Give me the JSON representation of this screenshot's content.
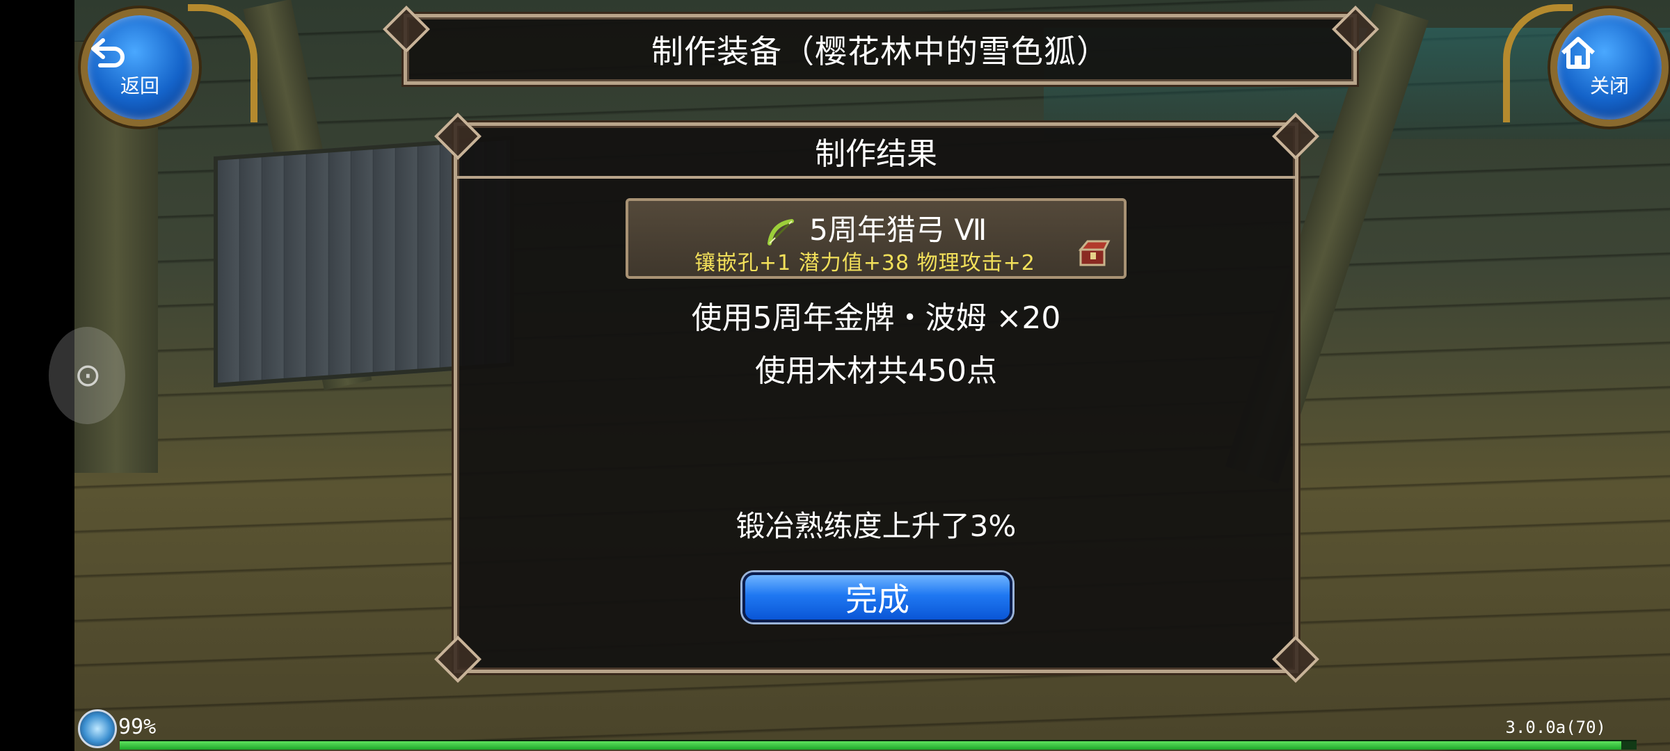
{
  "nav": {
    "back_label": "返回",
    "close_label": "关闭"
  },
  "title": "制作装备（樱花林中的雪色狐）",
  "panel": {
    "header": "制作结果",
    "item": {
      "name": "5周年猎弓 Ⅶ",
      "stats": "镶嵌孔+1 潜力值+38 物理攻击+2",
      "icon": "bow-icon",
      "secondary_icon": "treasure-box-icon"
    },
    "material_line": "使用5周年金牌・波姆 ×20",
    "wood_line": "使用木材共450点",
    "skill_line": "锻冶熟练度上升了3%",
    "done_button": "完成"
  },
  "status": {
    "percent": "99%",
    "progress_fraction": 0.99,
    "version": "3.0.0a(70)"
  },
  "colors": {
    "accent_blue": "#1f78f2",
    "stat_yellow": "#f2e05a",
    "frame_gold": "#b8a48a",
    "progress_green": "#1ea72a"
  }
}
